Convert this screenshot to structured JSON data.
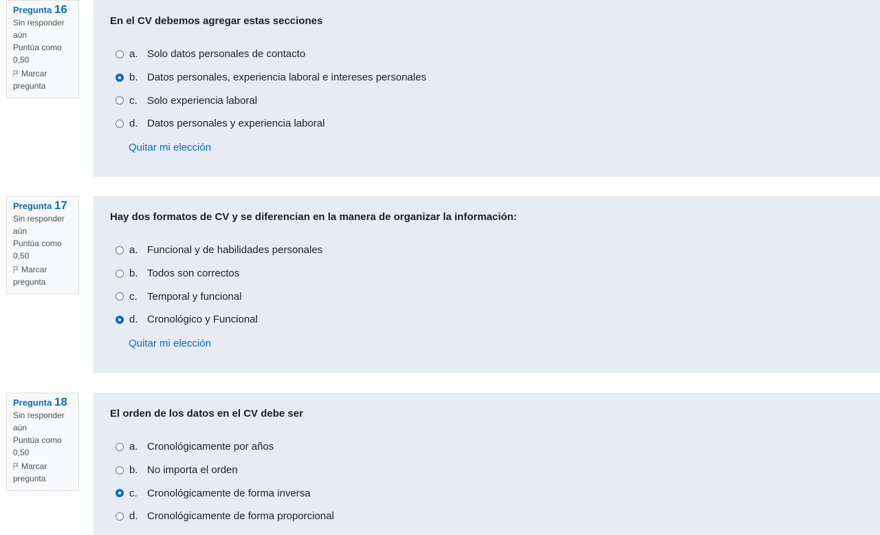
{
  "questions": [
    {
      "label": "Pregunta",
      "number": "16",
      "state": "Sin responder aún",
      "grade": "Puntúa como 0,50",
      "flag_label": "Marcar pregunta",
      "text": "En el CV debemos agregar estas secciones",
      "answers": [
        {
          "letter": "a.",
          "text": "Solo datos personales de contacto",
          "checked": false
        },
        {
          "letter": "b.",
          "text": "Datos personales, experiencia laboral e intereses personales",
          "checked": true
        },
        {
          "letter": "c.",
          "text": "Solo experiencia laboral",
          "checked": false
        },
        {
          "letter": "d.",
          "text": "Datos personales y  experiencia laboral",
          "checked": false
        }
      ],
      "clear_label": "Quitar mi elección"
    },
    {
      "label": "Pregunta",
      "number": "17",
      "state": "Sin responder aún",
      "grade": "Puntúa como 0,50",
      "flag_label": "Marcar pregunta",
      "text": "Hay dos formatos de CV y se diferencian en la manera de organizar la información:",
      "answers": [
        {
          "letter": "a.",
          "text": "Funcional y de habilidades personales",
          "checked": false
        },
        {
          "letter": "b.",
          "text": "Todos son correctos",
          "checked": false
        },
        {
          "letter": "c.",
          "text": "Temporal y funcional",
          "checked": false
        },
        {
          "letter": "d.",
          "text": "Cronológico y Funcional",
          "checked": true
        }
      ],
      "clear_label": "Quitar mi elección"
    },
    {
      "label": "Pregunta",
      "number": "18",
      "state": "Sin responder aún",
      "grade": "Puntúa como 0,50",
      "flag_label": "Marcar pregunta",
      "text": "El orden de los datos en el CV debe ser",
      "answers": [
        {
          "letter": "a.",
          "text": "Cronológicamente por años",
          "checked": false
        },
        {
          "letter": "b.",
          "text": "No importa el orden",
          "checked": false
        },
        {
          "letter": "c.",
          "text": "Cronológicamente de forma inversa",
          "checked": true
        },
        {
          "letter": "d.",
          "text": "Cronológicamente de forma proporcional",
          "checked": false
        }
      ],
      "clear_label": ""
    }
  ],
  "icons": {
    "flag": "flag-icon"
  },
  "colors": {
    "accent": "#0f6cbf",
    "panel_bg": "#e7ebf3",
    "info_bg": "#f8f9fa"
  }
}
